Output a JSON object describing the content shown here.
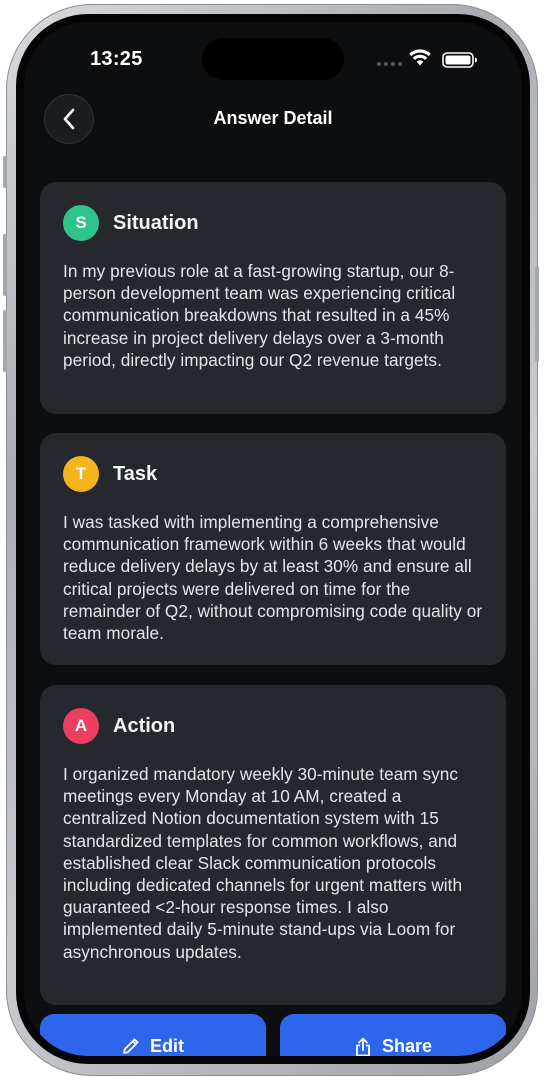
{
  "status_bar": {
    "time": "13:25"
  },
  "header": {
    "title": "Answer Detail",
    "back_icon": "chevron-left-icon"
  },
  "sections": [
    {
      "letter": "S",
      "title": "Situation",
      "color": "#2fc48a",
      "text": "In my previous role at a fast-growing startup, our 8-person development team was experiencing critical communication breakdowns that resulted in a 45% increase in project delivery delays over a 3-month period, directly impacting our Q2 revenue targets."
    },
    {
      "letter": "T",
      "title": "Task",
      "color": "#f2b61c",
      "text": "I was tasked with implementing a comprehensive communication framework within 6 weeks that would reduce delivery delays by at least 30% and ensure all critical projects were delivered on time for the remainder of Q2, without compromising code quality or team morale."
    },
    {
      "letter": "A",
      "title": "Action",
      "color": "#ec3e5f",
      "text": "I organized mandatory weekly 30-minute team sync meetings every Monday at 10 AM, created a centralized Notion documentation system with 15 standardized templates for common workflows, and established clear Slack communication protocols including dedicated channels for urgent matters with guaranteed <2-hour response times. I also implemented daily 5-minute stand-ups via Loom for asynchronous updates."
    }
  ],
  "actions": {
    "edit_label": "Edit",
    "edit_icon": "pencil-icon",
    "share_label": "Share",
    "share_icon": "share-icon"
  },
  "colors": {
    "background": "#0d0e10",
    "card": "#26282e",
    "primary_button": "#2d66ea"
  }
}
